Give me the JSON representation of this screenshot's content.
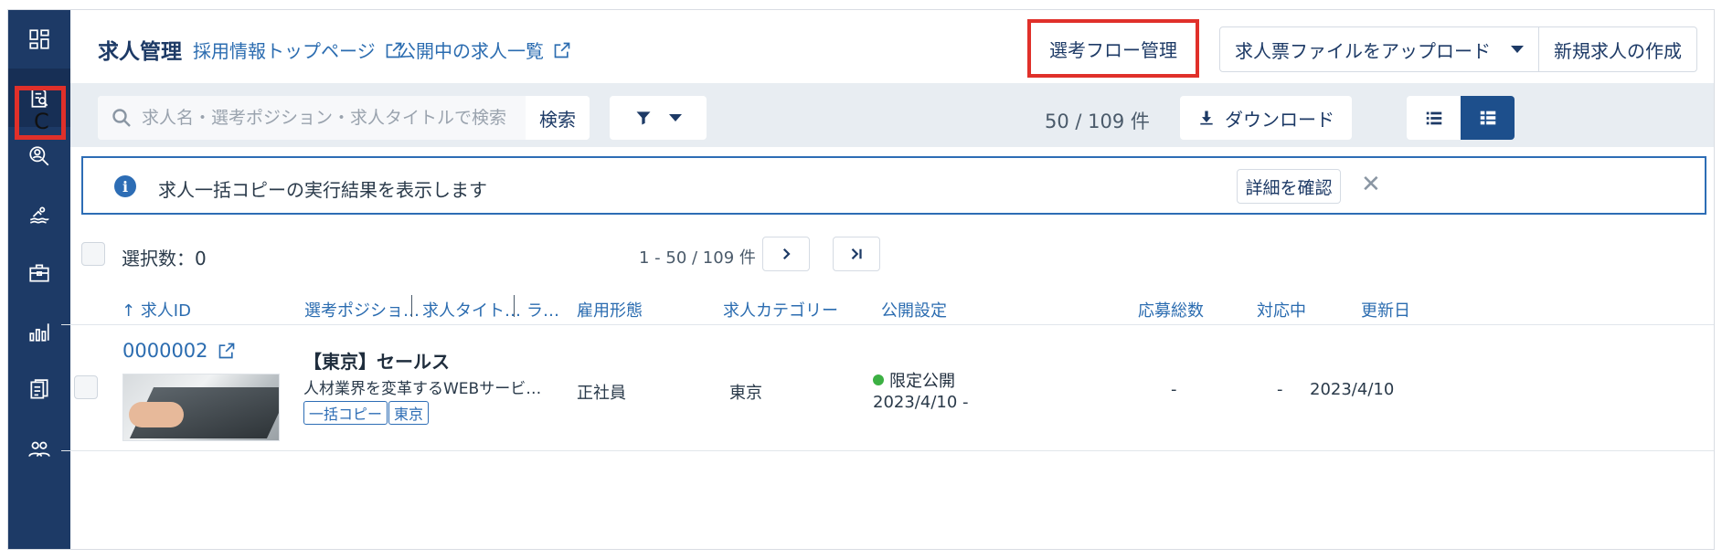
{
  "sidebar": {
    "items": [
      {
        "name": "dashboard-icon"
      },
      {
        "name": "job-management-icon"
      },
      {
        "name": "candidate-search-icon"
      },
      {
        "name": "swimmer-icon"
      },
      {
        "name": "briefcase-icon"
      },
      {
        "name": "bar-chart-icon"
      },
      {
        "name": "document-list-icon"
      },
      {
        "name": "users-icon"
      }
    ],
    "cursor_text": "C"
  },
  "header": {
    "title": "求人管理",
    "link_top": "採用情報トップページ",
    "link_public": "公開中の求人一覧",
    "flow_button": "選考フロー管理",
    "upload_button": "求人票ファイルをアップロード",
    "new_job_button": "新規求人の作成"
  },
  "toolbar": {
    "search_placeholder": "求人名・選考ポジション・求人タイトルで検索",
    "search_button": "検索",
    "count": "50 / 109 件",
    "download_button": "ダウンロード"
  },
  "notice": {
    "message": "求人一括コピーの実行結果を表示します",
    "detail_button": "詳細を確認",
    "close": "✕"
  },
  "selection": {
    "label": "選択数：0",
    "range": "1 - 50 / 109 件"
  },
  "table": {
    "columns": [
      "求人ID",
      "選考ポジショ…",
      "求人タイト…",
      "ラ…",
      "雇用形態",
      "求人カテゴリー",
      "公開設定",
      "応募総数",
      "対応中",
      "更新日"
    ],
    "rows": [
      {
        "id": "0000002",
        "title": "【東京】セールス",
        "subtitle": "人材業界を変革するWEBサービスの企画営業",
        "tags": [
          "一括コピー",
          "東京"
        ],
        "employment": "正社員",
        "category": "東京",
        "status": "限定公開",
        "publish_period": "2023/4/10 -",
        "applications": "-",
        "in_progress": "-",
        "updated": "2023/4/10"
      }
    ]
  },
  "colors": {
    "sidebar": "#1d3a66",
    "accent": "#2b6cb0",
    "highlight": "#e0302a",
    "status_green": "#3cb043"
  }
}
